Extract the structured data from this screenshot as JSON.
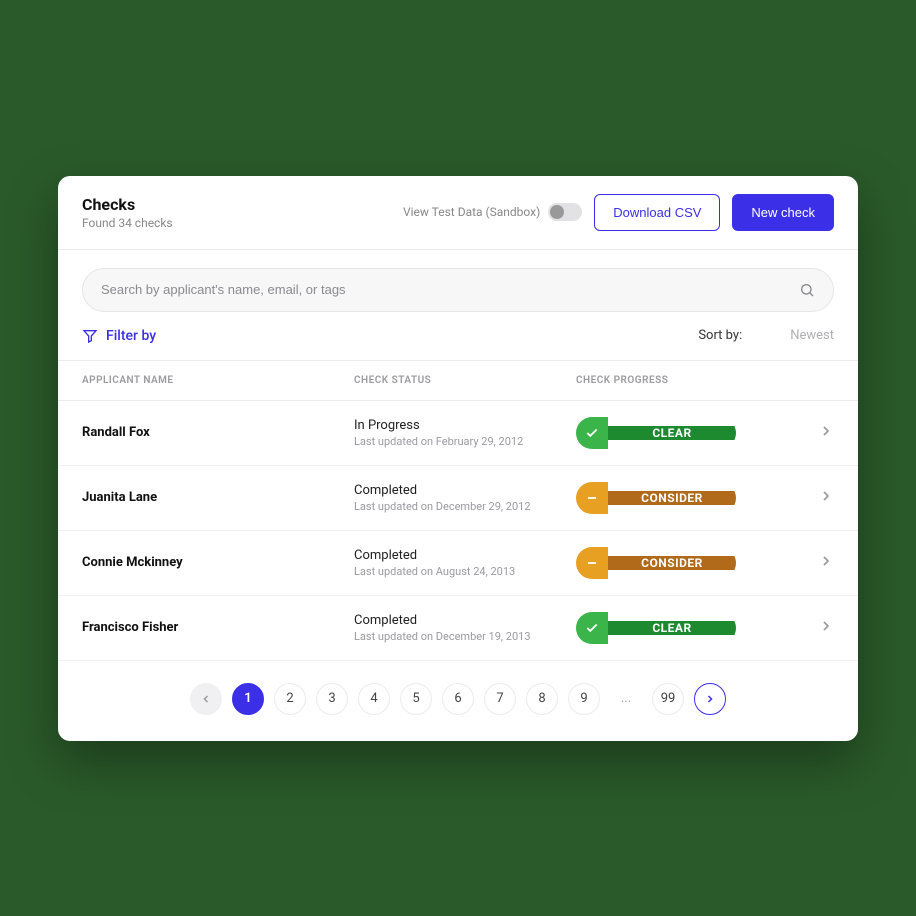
{
  "header": {
    "title": "Checks",
    "subtitle": "Found 34 checks",
    "toggle_label": "View Test Data (Sandbox)",
    "download_label": "Download CSV",
    "new_label": "New check"
  },
  "search": {
    "placeholder": "Search by applicant's name, email, or tags"
  },
  "filter": {
    "label": "Filter by"
  },
  "sort": {
    "label": "Sort by:",
    "value": "Newest"
  },
  "columns": {
    "name": "APPLICANT NAME",
    "status": "CHECK STATUS",
    "progress": "CHECK PROGRESS"
  },
  "rows": [
    {
      "name": "Randall Fox",
      "status": "In Progress",
      "updated": "Last updated on February 29, 2012",
      "badge_type": "clear",
      "badge_text": "CLEAR"
    },
    {
      "name": "Juanita Lane",
      "status": "Completed",
      "updated": "Last updated on December 29, 2012",
      "badge_type": "consider",
      "badge_text": "CONSIDER"
    },
    {
      "name": "Connie Mckinney",
      "status": "Completed",
      "updated": "Last updated on August 24, 2013",
      "badge_type": "consider",
      "badge_text": "CONSIDER"
    },
    {
      "name": "Francisco Fisher",
      "status": "Completed",
      "updated": "Last updated on December 19, 2013",
      "badge_type": "clear",
      "badge_text": "CLEAR"
    }
  ],
  "pagination": {
    "pages": [
      "1",
      "2",
      "3",
      "4",
      "5",
      "6",
      "7",
      "8",
      "9"
    ],
    "ellipsis": "...",
    "last": "99",
    "active": "1"
  }
}
